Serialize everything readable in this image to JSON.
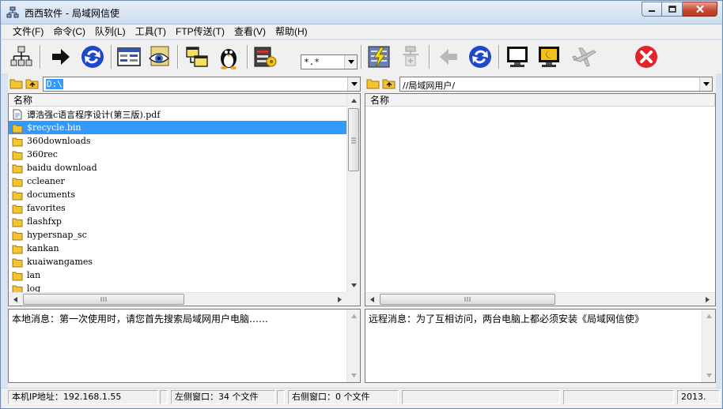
{
  "window": {
    "title": "西西软件 - 局域网信使"
  },
  "menu": [
    {
      "label": "文件(F)"
    },
    {
      "label": "命令(C)"
    },
    {
      "label": "队列(L)"
    },
    {
      "label": "工具(T)"
    },
    {
      "label": "FTP传送(T)"
    },
    {
      "label": "查看(V)"
    },
    {
      "label": "帮助(H)"
    }
  ],
  "toolbar": {
    "filter_value": "*.*",
    "icons": [
      "network-tree-icon",
      "arrow-right-icon",
      "refresh-icon",
      "browser-icon",
      "view-eye-icon",
      "copy-windows-icon",
      "penguin-icon",
      "tools-icon",
      "connect-icon",
      "disconnect-icon",
      "arrow-left-icon",
      "refresh-icon",
      "monitor-icon",
      "screen-capture-icon",
      "airplane-icon",
      "close-circle-icon"
    ]
  },
  "left_pane": {
    "path": "D:\\",
    "column_name": "名称",
    "files": [
      {
        "name": "谭浩强c语言程序设计(第三版).pdf",
        "type": "file"
      },
      {
        "name": "$recycle.bin",
        "type": "folder",
        "selected": true
      },
      {
        "name": "360downloads",
        "type": "folder"
      },
      {
        "name": "360rec",
        "type": "folder"
      },
      {
        "name": "baidu download",
        "type": "folder"
      },
      {
        "name": "ccleaner",
        "type": "folder"
      },
      {
        "name": "documents",
        "type": "folder"
      },
      {
        "name": "favorites",
        "type": "folder"
      },
      {
        "name": "flashfxp",
        "type": "folder"
      },
      {
        "name": "hypersnap_sc",
        "type": "folder"
      },
      {
        "name": "kankan",
        "type": "folder"
      },
      {
        "name": "kuaiwangames",
        "type": "folder"
      },
      {
        "name": "lan",
        "type": "folder"
      },
      {
        "name": "log",
        "type": "folder"
      }
    ],
    "message": "本地消息：第一次使用时，请您首先搜索局域网用户电脑……"
  },
  "right_pane": {
    "path": "//局域网用户/",
    "column_name": "名称",
    "message": "远程消息：为了互相访问，两台电脑上都必须安装《局域网信使》"
  },
  "status": {
    "ip": "本机IP地址：192.168.1.55",
    "left_window": "左侧窗口：34 个文件",
    "right_window": "右侧窗口：0 个文件",
    "year": "2013."
  },
  "colors": {
    "selection": "#3399ff",
    "folder": "#f5c431",
    "close_red": "#e0262b",
    "blue_refresh": "#1f47c9"
  }
}
